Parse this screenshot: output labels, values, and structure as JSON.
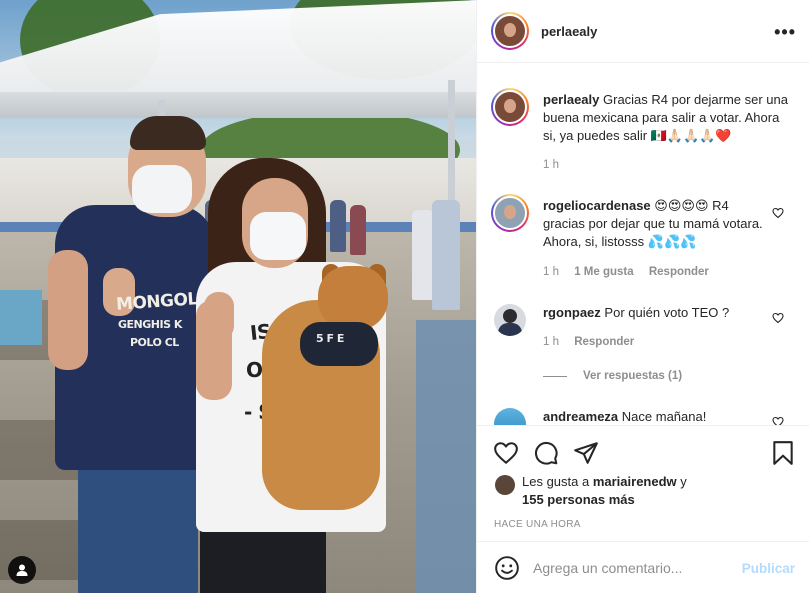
{
  "post": {
    "author": "perlaealy",
    "more_icon": "ellipsis-icon",
    "more_label": "•••"
  },
  "photo": {
    "man_shirt_line1": "MONGOL",
    "man_shirt_line2": "GENGHIS K",
    "man_shirt_line3": "POLO CL",
    "woman_shirt_line1": "IS NO",
    "woman_shirt_line2": "OSC",
    "woman_shirt_line3": "- SHIR",
    "dog_harness_text": "5 F E",
    "user_tag_icon": "person-tag-icon"
  },
  "caption": {
    "username": "perlaealy",
    "text": "Gracias R4 por dejarme ser una buena mexicana para salir a votar. Ahora si, ya puedes salir 🇲🇽🙏🏻🙏🏻🙏🏻❤️",
    "time": "1 h"
  },
  "comments": [
    {
      "username": "rogeliocardenase",
      "text": "😍😍😍😍 R4 gracias por dejar que tu mamá votara. Ahora, si, listosss 💦💦💦",
      "time": "1 h",
      "likes": "1 Me gusta",
      "reply": "Responder"
    },
    {
      "username": "rgonpaez",
      "text": "Por quién voto TEO ?",
      "time": "1 h",
      "reply": "Responder",
      "view_replies": "Ver respuestas (1)"
    },
    {
      "username": "andreameza",
      "text": "Nace mañana!"
    }
  ],
  "actions": {
    "like_icon": "heart-icon",
    "comment_icon": "comment-icon",
    "share_icon": "send-icon",
    "save_icon": "bookmark-icon"
  },
  "likes": {
    "line1_prefix": "Les gusta a ",
    "line1_user": "mariairenedw",
    "line1_suffix": " y",
    "line2": "155 personas más"
  },
  "timestamp": "HACE UNA HORA",
  "add_comment": {
    "placeholder": "Agrega un comentario...",
    "emoji_icon": "smiley-icon",
    "publish_label": "Publicar"
  },
  "colors": {
    "accent_disabled": "#b3dbff",
    "heart_red": "#ed4956",
    "muted": "#8e8e8e"
  }
}
